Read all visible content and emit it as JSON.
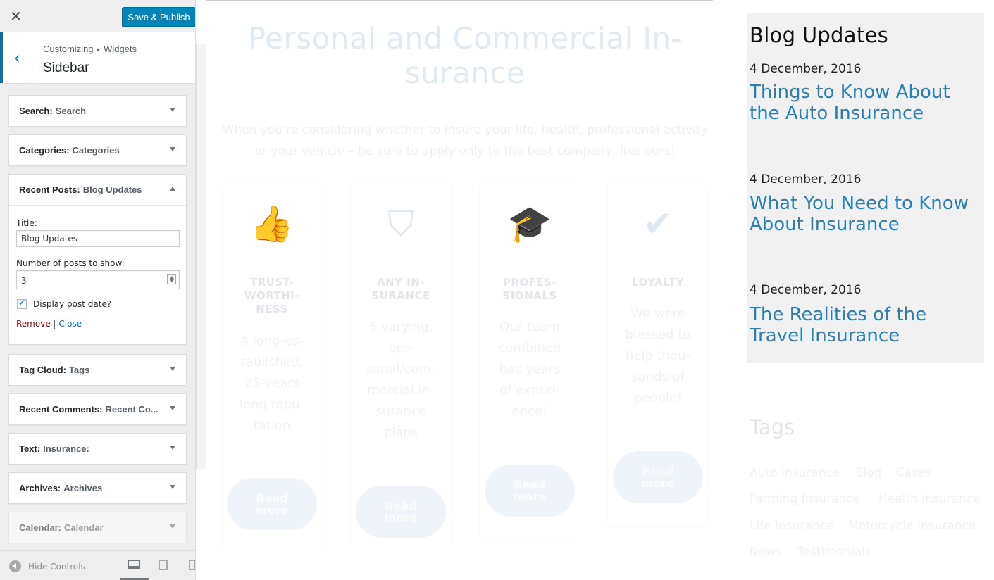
{
  "customizer": {
    "close_icon": "close-icon",
    "save_label": "Save & Publish",
    "accent_color": "#0085ba",
    "breadcrumb": [
      "Customizing",
      "Widgets"
    ],
    "section_title": "Sidebar",
    "widgets": [
      {
        "type": "Search:",
        "name": "Search",
        "expanded": false
      },
      {
        "type": "Categories:",
        "name": "Categories",
        "expanded": false
      },
      {
        "type": "Recent Posts:",
        "name": "Blog Updates",
        "expanded": true
      },
      {
        "type": "Tag Cloud:",
        "name": "Tags",
        "expanded": false
      },
      {
        "type": "Recent Comments:",
        "name": "Recent Co...",
        "expanded": false
      },
      {
        "type": "Text:",
        "name": "Insurance:",
        "expanded": false
      },
      {
        "type": "Archives:",
        "name": "Archives",
        "expanded": false
      },
      {
        "type": "Calendar:",
        "name": "Calendar",
        "expanded": false
      }
    ],
    "recent_posts_form": {
      "title_label": "Title:",
      "title_value": "Blog Updates",
      "number_label": "Number of posts to show:",
      "number_value": "3",
      "display_date_label": "Display post date?",
      "display_date_checked": true,
      "remove_label": "Remove",
      "separator": "|",
      "close_label": "Close"
    },
    "footer": {
      "hide_controls_label": "Hide Controls",
      "devices": [
        "desktop",
        "tablet",
        "mobile"
      ],
      "active_device": "desktop"
    }
  },
  "preview": {
    "hero_title": "Personal and Commercial In-surance",
    "hero_subtitle": "When you’re considering whether to insure your life, health, professional activity or your vehicle – be sure to apply only to the best company, like ours!",
    "features": [
      {
        "icon": "thumbs-up-icon",
        "glyph": "👍",
        "title": "TRUST-\nWORTHI-\nNESS",
        "text": "A long-es-\ntablished,\n25-years\nlong repu-\ntation",
        "button": "Read\nmore"
      },
      {
        "icon": "pocket-shield-icon",
        "glyph": "⛉",
        "title": "ANY IN-\nSURANCE",
        "text": "6 varying,\nper-\nsonal/com-\nmercial in-\nsurance\nplans",
        "button": "Read\nmore"
      },
      {
        "icon": "graduation-cap-icon",
        "glyph": "🎓",
        "title": "PROFES-\nSIONALS",
        "text": "Our team\ncombined\nhas years\nof experi-\nence!",
        "button": "Read\nmore"
      },
      {
        "icon": "checkmark-icon",
        "glyph": "✔",
        "title": "LOYALTY",
        "text": "We were\nblessed to\nhelp thou-\nsands of\npeople!",
        "button": "Read\nmore"
      }
    ],
    "blog": {
      "title": "Blog Updates",
      "posts": [
        {
          "date": "4 December, 2016",
          "title": "Things to Know About the Auto Insurance"
        },
        {
          "date": "4 December, 2016",
          "title": "What You Need to Know About Insurance"
        },
        {
          "date": "4 December, 2016",
          "title": "The Realities of the Travel Insurance"
        }
      ],
      "link_color": "#2b7fb3"
    },
    "tags": {
      "title": "Tags",
      "items": [
        "Auto Insurance",
        "Blog",
        "Cases",
        "Farming Insurance",
        "Health Insurance",
        "Life Insurance",
        "Motorcycle Insurance",
        "News",
        "Testimonials"
      ]
    }
  }
}
